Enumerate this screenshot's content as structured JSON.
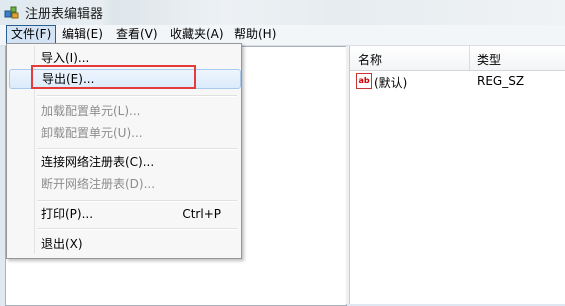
{
  "window": {
    "title": "注册表编辑器"
  },
  "menubar": [
    {
      "label": "文件(F)"
    },
    {
      "label": "编辑(E)"
    },
    {
      "label": "查看(V)"
    },
    {
      "label": "收藏夹(A)"
    },
    {
      "label": "帮助(H)"
    }
  ],
  "file_menu": {
    "items": [
      {
        "label": "导入(I)...",
        "enabled": true
      },
      {
        "label": "导出(E)...",
        "enabled": true,
        "highlighted": true
      },
      {
        "label": "加载配置单元(L)...",
        "enabled": false
      },
      {
        "label": "卸载配置单元(U)...",
        "enabled": false
      },
      {
        "label": "连接网络注册表(C)...",
        "enabled": true
      },
      {
        "label": "断开网络注册表(D)...",
        "enabled": false
      },
      {
        "label": "打印(P)...",
        "enabled": true,
        "shortcut": "Ctrl+P"
      },
      {
        "label": "退出(X)",
        "enabled": true
      }
    ]
  },
  "list": {
    "columns": {
      "name": "名称",
      "type": "类型"
    },
    "rows": [
      {
        "icon": "ab-string-icon",
        "name": "(默认)",
        "type": "REG_SZ"
      }
    ]
  },
  "annotation": {
    "color": "#e53b3b"
  },
  "colors": {
    "menu_active_border": "#2b5f93",
    "disabled_text": "#8d8d8d"
  }
}
